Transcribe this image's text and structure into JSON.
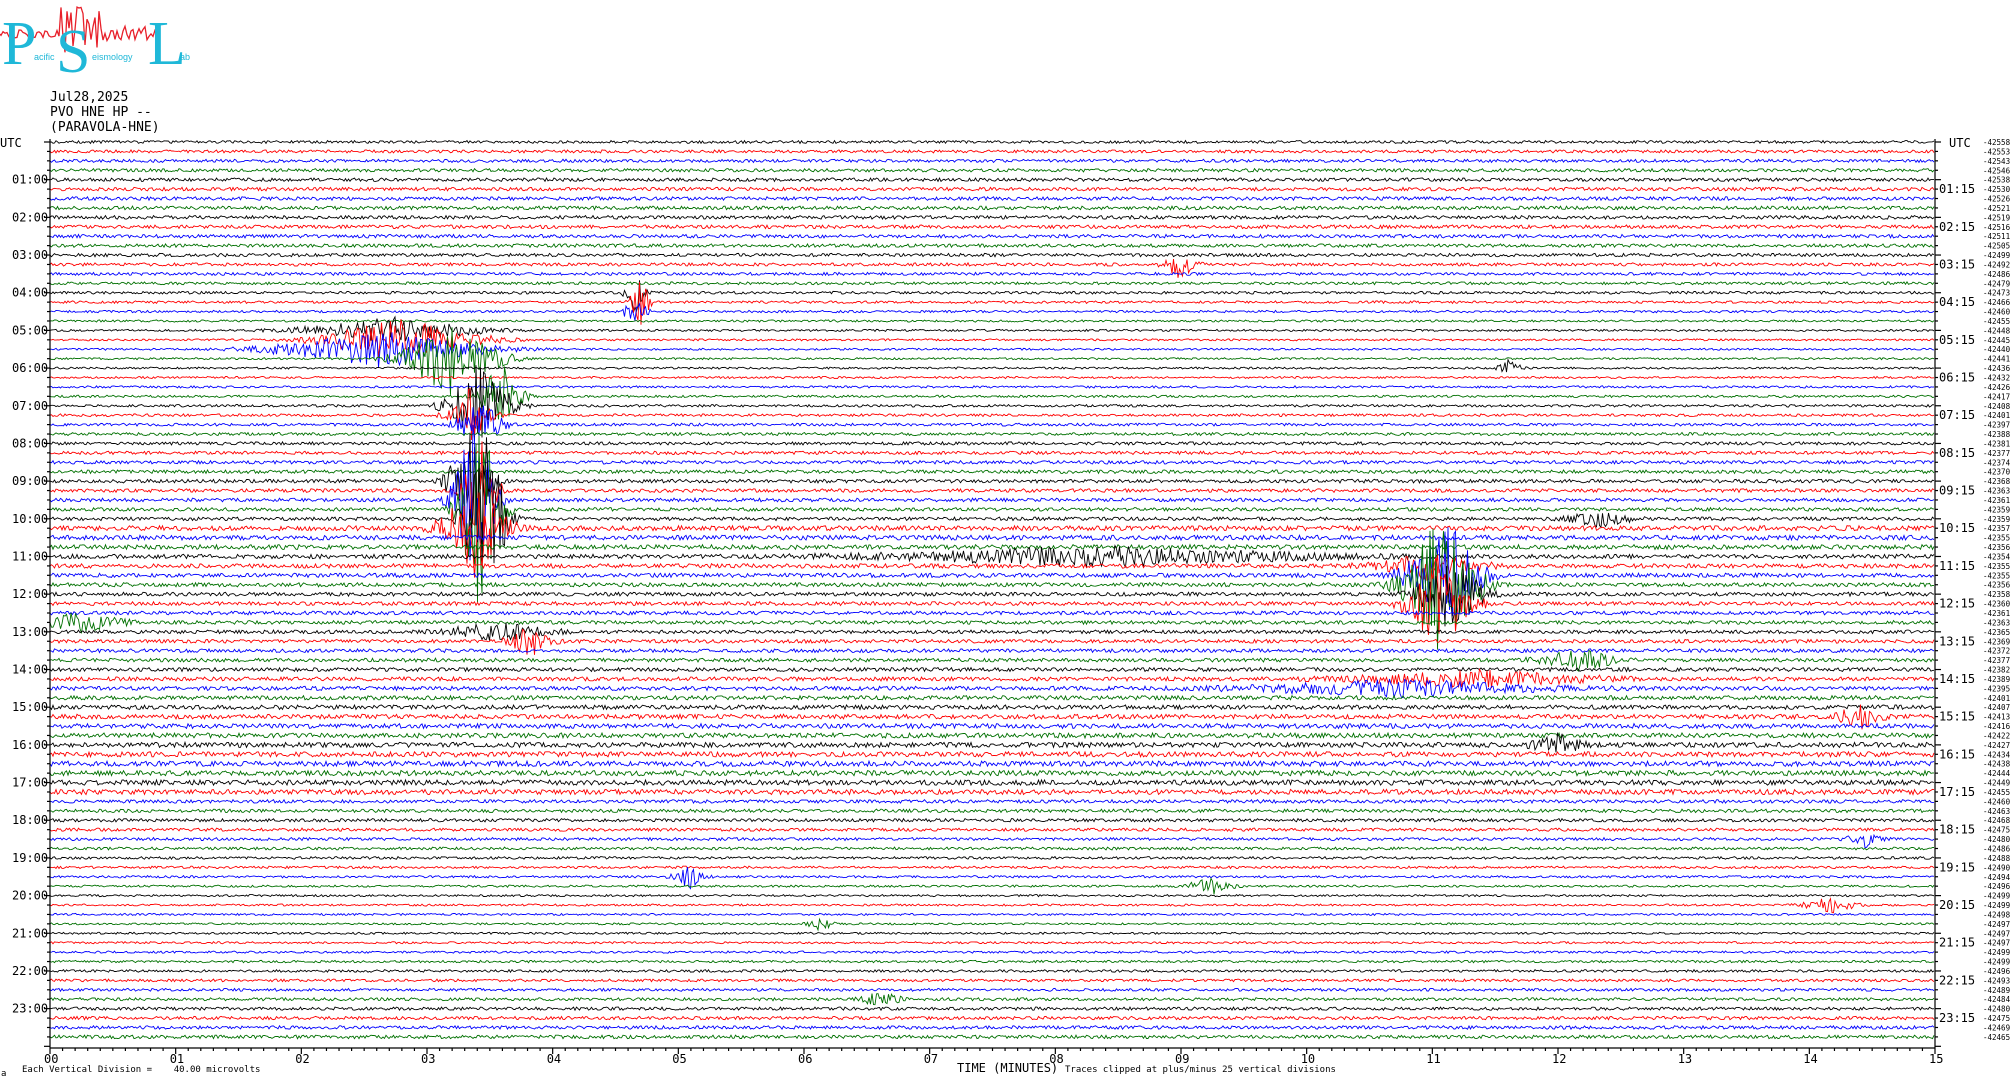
{
  "logo": {
    "letters": [
      "P",
      "S",
      "L"
    ],
    "small_words": [
      "acific",
      "eismology",
      "ab"
    ],
    "colors": {
      "letters": "#1fb8d8",
      "trace": "#e8202a"
    }
  },
  "header": {
    "date": "Jul28,2025",
    "channel": "PVO HNE HP --",
    "station": "(PARAVOLA-HNE)"
  },
  "footer": {
    "vertical_division": "Each Vertical Division =    40.00 microvolts",
    "clip_note": "Traces clipped at plus/minus 25 vertical divisions",
    "corner_mark": "a"
  },
  "chart_data": {
    "type": "line",
    "title": "",
    "xlabel": "TIME (MINUTES)",
    "ylabel": "",
    "x_range": [
      0,
      15
    ],
    "x_ticks": [
      "00",
      "01",
      "02",
      "03",
      "04",
      "05",
      "06",
      "07",
      "08",
      "09",
      "10",
      "11",
      "12",
      "13",
      "14",
      "15"
    ],
    "rows_per_hour": 4,
    "row_minutes": 15,
    "row_count": 96,
    "series_colors": [
      "#000000",
      "#ff0000",
      "#0000ff",
      "#007000"
    ],
    "left_axis_label": "UTC",
    "right_axis_label": "UTC",
    "left_hour_labels": [
      "01:00",
      "02:00",
      "03:00",
      "04:00",
      "05:00",
      "06:00",
      "07:00",
      "08:00",
      "09:00",
      "10:00",
      "11:00",
      "12:00",
      "13:00",
      "14:00",
      "15:00",
      "16:00",
      "17:00",
      "18:00",
      "19:00",
      "20:00",
      "21:00",
      "22:00",
      "23:00"
    ],
    "right_hour_labels": [
      "01:15",
      "02:15",
      "03:15",
      "04:15",
      "05:15",
      "06:15",
      "07:15",
      "08:15",
      "09:15",
      "10:15",
      "11:15",
      "12:15",
      "13:15",
      "14:15",
      "15:15",
      "16:15",
      "17:15",
      "18:15",
      "19:15",
      "20:15",
      "21:15",
      "22:15",
      "23:15"
    ],
    "row_offsets": [
      "-42558",
      "-42553",
      "-42543",
      "-42546",
      "-42538",
      "-42530",
      "-42526",
      "-42521",
      "-42519",
      "-42516",
      "-42511",
      "-42505",
      "-42499",
      "-42492",
      "-42486",
      "-42479",
      "-42473",
      "-42466",
      "-42460",
      "-42455",
      "-42448",
      "-42445",
      "-42440",
      "-42441",
      "-42436",
      "-42432",
      "-42426",
      "-42417",
      "-42408",
      "-42401",
      "-42397",
      "-42388",
      "-42381",
      "-42377",
      "-42374",
      "-42370",
      "-42368",
      "-42363",
      "-42361",
      "-42359",
      "-42359",
      "-42357",
      "-42355",
      "-42356",
      "-42354",
      "-42355",
      "-42355",
      "-42356",
      "-42358",
      "-42360",
      "-42361",
      "-42363",
      "-42365",
      "-42369",
      "-42372",
      "-42377",
      "-42382",
      "-42389",
      "-42395",
      "-42401",
      "-42407",
      "-42413",
      "-42416",
      "-42422",
      "-42427",
      "-42434",
      "-42438",
      "-42444",
      "-42449",
      "-42455",
      "-42460",
      "-42463",
      "-42468",
      "-42475",
      "-42480",
      "-42486",
      "-42488",
      "-42490",
      "-42494",
      "-42496",
      "-42499",
      "-42499",
      "-42498",
      "-42497",
      "-42497",
      "-42497",
      "-42499",
      "-42499",
      "-42496",
      "-42493",
      "-42489",
      "-42484",
      "-42480",
      "-42475",
      "-42469",
      "-42465"
    ]
  }
}
